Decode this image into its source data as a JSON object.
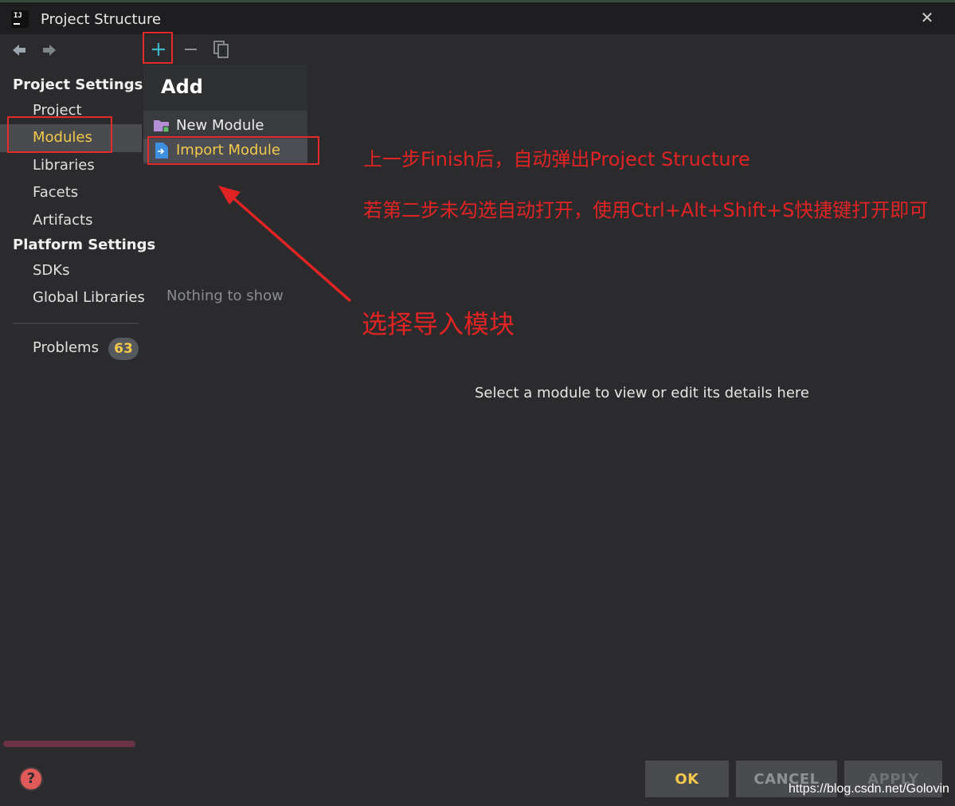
{
  "window": {
    "title": "Project Structure"
  },
  "toolbar": {
    "add_icon": "plus-icon",
    "remove_icon": "minus-icon",
    "copy_icon": "copy-icon"
  },
  "nav": {
    "back_icon": "arrow-left-icon",
    "forward_icon": "arrow-right-icon"
  },
  "sidebar": {
    "project_settings": "Project Settings",
    "project_items": [
      "Project",
      "Modules",
      "Libraries",
      "Facets",
      "Artifacts"
    ],
    "platform_settings": "Platform Settings",
    "platform_items": [
      "SDKs",
      "Global Libraries"
    ],
    "problems_label": "Problems",
    "problems_count": "63",
    "selected": "Modules"
  },
  "popup": {
    "title": "Add",
    "items": [
      {
        "label": "New Module",
        "icon": "folder-icon"
      },
      {
        "label": "Import Module",
        "icon": "import-file-icon"
      }
    ]
  },
  "middle": {
    "empty_text": "Nothing to show"
  },
  "details": {
    "hint": "Select a module to view or edit its details here"
  },
  "annotations": {
    "line1": "上一步Finish后，自动弹出Project Structure",
    "line2": "若第二步未勾选自动打开，使用Ctrl+Alt+Shift+S快捷键打开即可",
    "callout": "选择导入模块"
  },
  "buttons": {
    "ok": "OK",
    "cancel": "CANCEL",
    "apply": "APPLY"
  },
  "watermark": "https://blog.csdn.net/Golovin",
  "colors": {
    "background": "#2b2b2e",
    "selection": "#4a4b4e",
    "highlight_text": "#f2c94c",
    "annotation": "#e02424",
    "accent": "#3fb6c8"
  }
}
